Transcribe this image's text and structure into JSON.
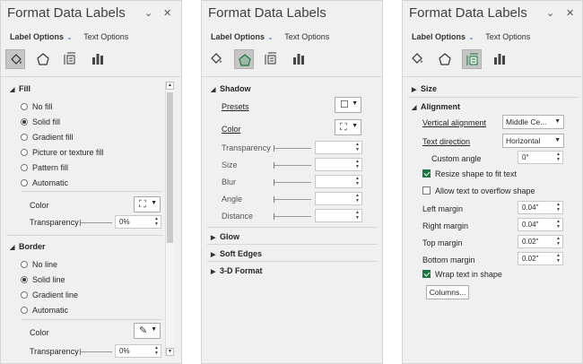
{
  "panes": [
    {
      "title": "Format Data Labels",
      "tabs": {
        "label_options": "Label Options",
        "text_options": "Text Options"
      },
      "fill": {
        "section": "Fill",
        "options": [
          "No fill",
          "Solid fill",
          "Gradient fill",
          "Picture or texture fill",
          "Pattern fill",
          "Automatic"
        ],
        "selected": "Solid fill",
        "color_label": "Color",
        "transparency_label": "Transparency",
        "transparency_value": "0%"
      },
      "border": {
        "section": "Border",
        "options": [
          "No line",
          "Solid line",
          "Gradient line",
          "Automatic"
        ],
        "selected": "Solid line",
        "color_label": "Color",
        "transparency_label": "Transparency",
        "transparency_value": "0%"
      }
    },
    {
      "title": "Format Data Labels",
      "tabs": {
        "label_options": "Label Options",
        "text_options": "Text Options"
      },
      "shadow": {
        "section": "Shadow",
        "presets_label": "Presets",
        "color_label": "Color",
        "fields": [
          "Transparency",
          "Size",
          "Blur",
          "Angle",
          "Distance"
        ]
      },
      "collapsed": [
        "Glow",
        "Soft Edges",
        "3-D Format"
      ]
    },
    {
      "title": "Format Data Labels",
      "tabs": {
        "label_options": "Label Options",
        "text_options": "Text Options"
      },
      "size_section": "Size",
      "alignment": {
        "section": "Alignment",
        "vertical_alignment_label": "Vertical alignment",
        "vertical_alignment_value": "Middle Ce...",
        "text_direction_label": "Text direction",
        "text_direction_value": "Horizontal",
        "custom_angle_label": "Custom angle",
        "custom_angle_value": "0°",
        "resize_label": "Resize shape to fit text",
        "resize_checked": true,
        "overflow_label": "Allow text to overflow shape",
        "overflow_checked": false,
        "margins": [
          {
            "label": "Left margin",
            "value": "0.04\""
          },
          {
            "label": "Right margin",
            "value": "0.04\""
          },
          {
            "label": "Top margin",
            "value": "0.02\""
          },
          {
            "label": "Bottom margin",
            "value": "0.02\""
          }
        ],
        "wrap_label": "Wrap text in shape",
        "wrap_checked": true,
        "columns_button": "Columns..."
      }
    }
  ],
  "colors": {
    "pane_bg": "#f0f0f0",
    "selected_icon_bg": "#c5c5c5",
    "checkbox_green": "#217346",
    "dropdown_accent": "#2b579a"
  },
  "icons": [
    "fill-line-icon",
    "effects-icon",
    "size-properties-icon",
    "label-options-icon",
    "collapse-icon",
    "close-icon"
  ]
}
